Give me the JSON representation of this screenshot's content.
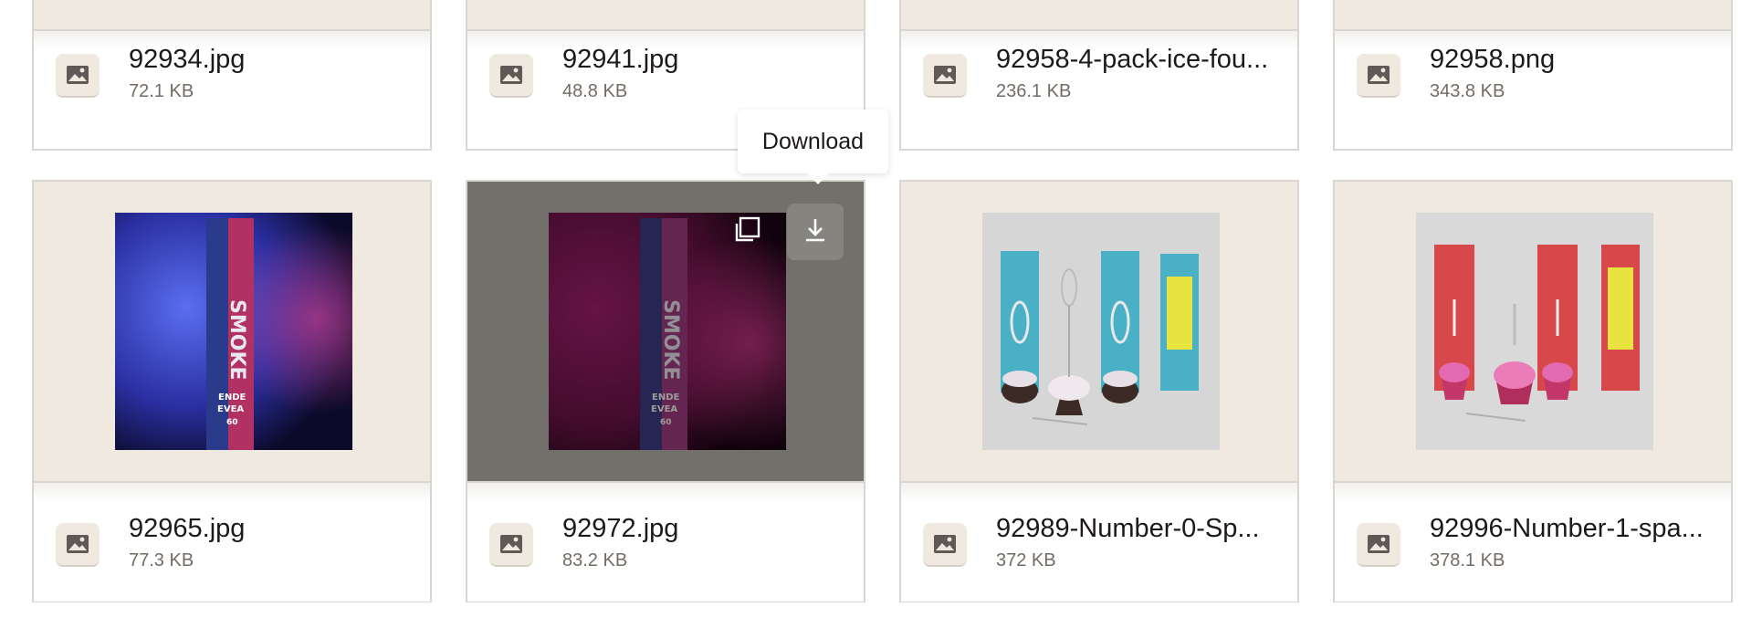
{
  "top_row": [
    {
      "name": "92934.jpg",
      "size": "72.1 KB"
    },
    {
      "name": "92941.jpg",
      "size": "48.8 KB"
    },
    {
      "name": "92958-4-pack-ice-fou...",
      "size": "236.1 KB"
    },
    {
      "name": "92958.png",
      "size": "343.8 KB"
    }
  ],
  "bottom_row": [
    {
      "name": "92965.jpg",
      "size": "77.3 KB"
    },
    {
      "name": "92972.jpg",
      "size": "83.2 KB"
    },
    {
      "name": "92989-Number-0-Sp...",
      "size": "372 KB"
    },
    {
      "name": "92996-Number-1-spa...",
      "size": "378.1 KB"
    }
  ],
  "tooltip": {
    "label": "Download"
  },
  "icons": {
    "file_type": "image-file-icon",
    "copy": "copy-icon",
    "download": "download-icon"
  },
  "colors": {
    "thumb_bg": "#efe9e0",
    "hover_overlay": "#73706b",
    "text_primary": "#1e1919",
    "text_secondary": "#736c64"
  }
}
